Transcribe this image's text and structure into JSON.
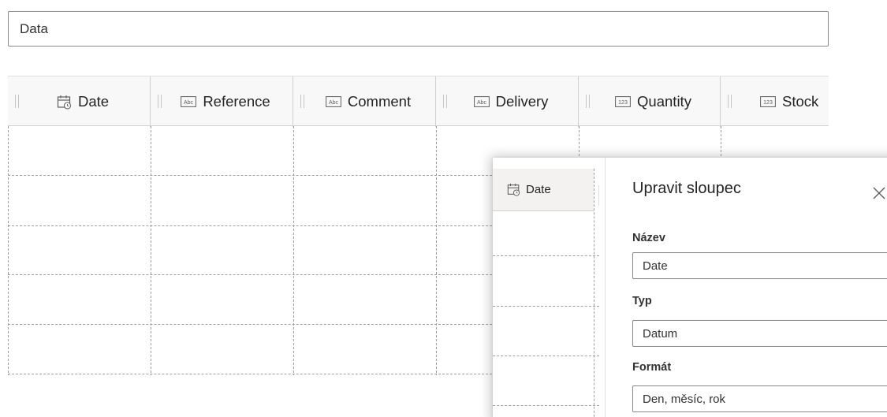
{
  "name_field": {
    "value": "Data"
  },
  "columns": [
    {
      "label": "Date",
      "icon": "calendar-icon"
    },
    {
      "label": "Reference",
      "icon": "text-abc-icon"
    },
    {
      "label": "Comment",
      "icon": "text-abc-icon"
    },
    {
      "label": "Delivery",
      "icon": "text-abc-icon"
    },
    {
      "label": "Quantity",
      "icon": "number-123-icon"
    },
    {
      "label": "Stock",
      "icon": "number-123-icon"
    }
  ],
  "icon_text": {
    "abc": "Abc",
    "num": "123"
  },
  "popup": {
    "mini_column": {
      "label": "Date",
      "icon": "calendar-icon"
    },
    "title": "Upravit sloupec",
    "fields": {
      "name": {
        "label": "Název",
        "value": "Date"
      },
      "type": {
        "label": "Typ",
        "value": "Datum"
      },
      "format": {
        "label": "Formát",
        "value": "Den, měsíc, rok"
      }
    }
  }
}
